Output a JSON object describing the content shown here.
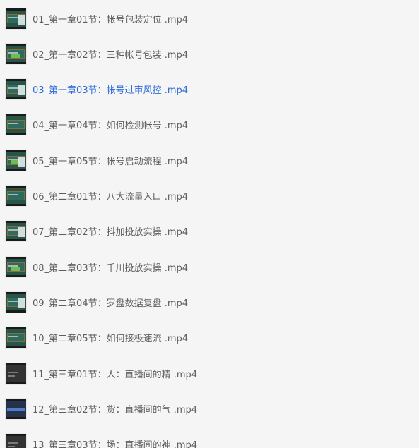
{
  "file_list": {
    "items": [
      {
        "name": "01_第一章01节：帐号包装定位 .mp4",
        "thumb": "board",
        "active": false
      },
      {
        "name": "02_第一章02节：三种帐号包装 .mp4",
        "thumb": "board",
        "active": false
      },
      {
        "name": "03_第一章03节：帐号过审风控 .mp4",
        "thumb": "board",
        "active": true
      },
      {
        "name": "04_第一章04节：如何检测帐号 .mp4",
        "thumb": "board",
        "active": false
      },
      {
        "name": "05_第一章05节：帐号启动流程 .mp4",
        "thumb": "board",
        "active": false
      },
      {
        "name": "06_第二章01节：八大流量入口 .mp4",
        "thumb": "board",
        "active": false
      },
      {
        "name": "07_第二章02节：抖加投放实操 .mp4",
        "thumb": "board",
        "active": false
      },
      {
        "name": "08_第二章03节：千川投放实操 .mp4",
        "thumb": "board",
        "active": false
      },
      {
        "name": "09_第二章04节：罗盘数据复盘 .mp4",
        "thumb": "board",
        "active": false
      },
      {
        "name": "10_第二章05节：如何接极速流 .mp4",
        "thumb": "board",
        "active": false
      },
      {
        "name": "11_第三章01节：人：直播间的精 .mp4",
        "thumb": "dark",
        "active": false
      },
      {
        "name": "12_第三章02节：货：直播间的气 .mp4",
        "thumb": "blue",
        "active": false
      },
      {
        "name": "13_第三章03节：场：直播间的神 .mp4",
        "thumb": "dark",
        "active": false
      }
    ]
  },
  "colors": {
    "background": "#f5f5f5",
    "text": "#5e5e5e",
    "active_text": "#2c6bd7"
  }
}
